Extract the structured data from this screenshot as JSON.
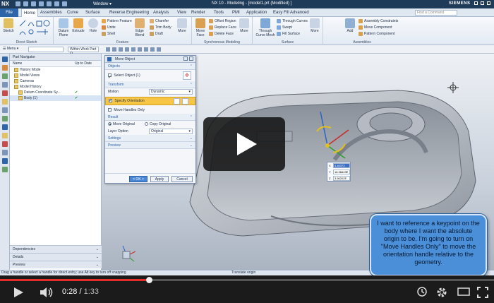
{
  "app": {
    "logo": "NX",
    "window_menu": "Window",
    "title": "NX 10 - Modeling - [model1.prt (Modified) ]",
    "brand": "SIEMENS"
  },
  "ribbon_tabs": {
    "file": "File",
    "items": [
      "Home",
      "Assemblies",
      "Curve",
      "Surface",
      "Reverse Engineering",
      "Analysis",
      "View",
      "Render",
      "Tools",
      "PMI",
      "Application",
      "Easy Fill Advanced"
    ],
    "active": "Home",
    "command_finder_placeholder": "Find a Command"
  },
  "ribbon": {
    "direct_sketch": {
      "label": "Direct Sketch",
      "sketch": "Sketch"
    },
    "feature": {
      "label": "Feature",
      "datum": "Datum Plane",
      "extrude": "Extrude",
      "hole": "Hole",
      "pattern_feature": "Pattern Feature",
      "unite": "Unite",
      "shell": "Shell",
      "edge_blend": "Edge Blend",
      "chamfer": "Chamfer",
      "trim_body": "Trim Body",
      "draft": "Draft",
      "more": "More"
    },
    "sync": {
      "label": "Synchronous Modeling",
      "move_face": "Move Face",
      "offset_region": "Offset Region",
      "replace_face": "Replace Face",
      "delete_face": "Delete Face",
      "more": "More"
    },
    "surface": {
      "label": "Surface",
      "through_curve_mesh": "Through Curve Mesh",
      "through_curves": "Through Curves",
      "swept": "Swept",
      "fill_surface": "Fill Surface",
      "more": "More"
    },
    "assemblies": {
      "label": "Assemblies",
      "add": "Add",
      "assembly_constraints": "Assembly Constraints",
      "move_component": "Move Component",
      "pattern_component": "Pattern Component"
    }
  },
  "selection_bar": {
    "menu": "Menu",
    "scope": "Within Work Part O"
  },
  "navigator": {
    "title": "Part Navigator",
    "col_name": "Name",
    "col_uptodate": "Up to Date",
    "rows": [
      {
        "label": "History Mode",
        "indent": 1,
        "check": ""
      },
      {
        "label": "Model Views",
        "indent": 1,
        "check": ""
      },
      {
        "label": "Cameras",
        "indent": 1,
        "check": ""
      },
      {
        "label": "Model History",
        "indent": 1,
        "check": ""
      },
      {
        "label": "Datum Coordinate Sy...",
        "indent": 2,
        "check": "✔"
      },
      {
        "label": "Body (1)",
        "indent": 2,
        "check": "✔"
      }
    ],
    "footer": [
      "Dependencies",
      "Details",
      "Preview"
    ]
  },
  "dialog": {
    "title": "Move Object",
    "objects_section": "Objects",
    "select_object": "Select Object (1)",
    "transform_section": "Transform",
    "motion_label": "Motion",
    "motion_value": "Dynamic",
    "specify_orientation": "Specify Orientation",
    "move_handles_only": "Move Handles Only",
    "result_section": "Result",
    "move_original": "Move Original",
    "copy_original": "Copy Original",
    "layer_option_label": "Layer Option",
    "layer_option_value": "Original",
    "settings_section": "Settings",
    "preview_section": "Preview",
    "ok": "< OK >",
    "apply": "Apply",
    "cancel": "Cancel"
  },
  "coord_readout": {
    "rows": [
      {
        "axis": "X",
        "value": "4.46373"
      },
      {
        "axis": "Y",
        "value": "18.36643E"
      },
      {
        "axis": "Z",
        "value": "3.56202E"
      }
    ]
  },
  "callout": {
    "text": "I want to reference a keypoint on the body where I want the absolute origin to be.  I'm going to turn on \"Move Handles Only\" to move the orientation handle relative to the geometry."
  },
  "status": {
    "left": "Drag a handle or select a handle for direct entry; use Alt key to turn off snapping",
    "center": "Translate origin"
  },
  "player": {
    "current_time": "0:28",
    "duration": "1:33",
    "progress": 0.301
  },
  "colors": {
    "accent": "#2e64a8",
    "highlight": "#f7c646",
    "progress": "#e52d27",
    "callout": "#4a8fd8"
  }
}
